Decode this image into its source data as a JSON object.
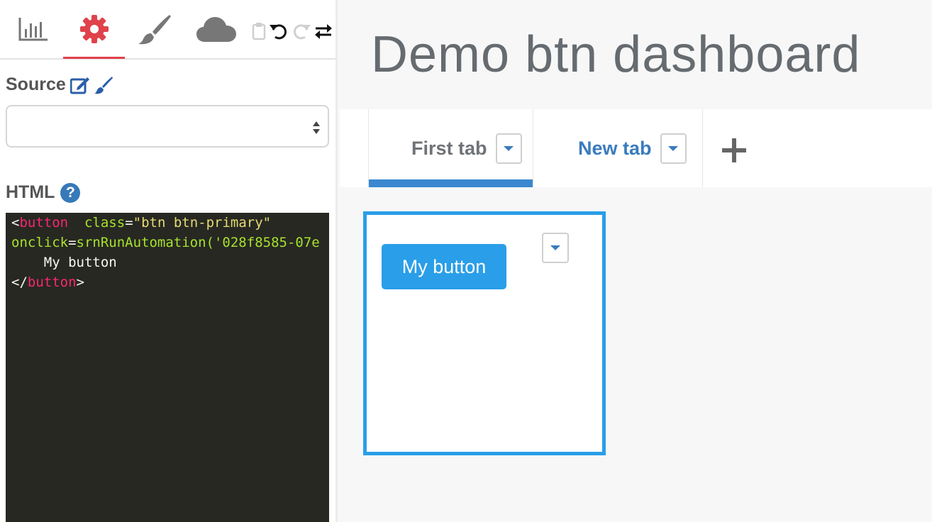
{
  "sidebar": {
    "toolbar": {
      "tabs": [
        {
          "icon": "chart-icon",
          "active": false
        },
        {
          "icon": "gear-icon",
          "active": true
        },
        {
          "icon": "brush-icon",
          "active": false
        },
        {
          "icon": "cloud-icon",
          "active": false
        }
      ],
      "small_tools": [
        "clipboard-icon",
        "undo-icon",
        "redo-icon",
        "swap-icon"
      ]
    },
    "source": {
      "label": "Source",
      "value": ""
    },
    "html": {
      "label": "HTML",
      "help": "?",
      "code_lines": [
        [
          {
            "t": "tag",
            "v": "<"
          },
          {
            "t": "tagname",
            "v": "button"
          },
          {
            "t": "plain",
            "v": "  "
          },
          {
            "t": "attr",
            "v": "class"
          },
          {
            "t": "plain",
            "v": "="
          },
          {
            "t": "str",
            "v": "\"btn btn-primary\""
          }
        ],
        [
          {
            "t": "attr",
            "v": "onclick"
          },
          {
            "t": "plain",
            "v": "="
          },
          {
            "t": "attrval",
            "v": "srnRunAutomation('028f8585-07e"
          }
        ],
        [
          {
            "t": "plain",
            "v": "    My button"
          }
        ],
        [
          {
            "t": "plain",
            "v": "</"
          },
          {
            "t": "tagname",
            "v": "button"
          },
          {
            "t": "plain",
            "v": ">"
          }
        ]
      ]
    }
  },
  "main": {
    "title": "Demo btn dashboard",
    "tabs": [
      {
        "label": "First tab",
        "active": true
      },
      {
        "label": "New tab",
        "active": false
      }
    ],
    "add_tab_symbol": "+",
    "widget": {
      "button_label": "My button"
    }
  },
  "colors": {
    "accent_red": "#e0424b",
    "accent_blue": "#2a9ee8",
    "tab_blue": "#3a7bbf",
    "editor_bg": "#272822"
  }
}
